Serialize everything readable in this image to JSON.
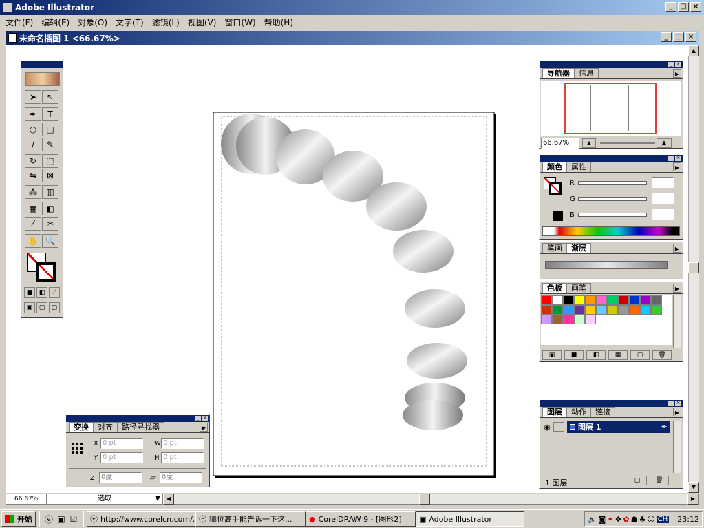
{
  "app": {
    "title": "Adobe Illustrator"
  },
  "menu": [
    "文件(F)",
    "编辑(E)",
    "对象(O)",
    "文字(T)",
    "滤镜(L)",
    "视图(V)",
    "窗口(W)",
    "帮助(H)"
  ],
  "document": {
    "title": "未命名插图 1 <66.67%>"
  },
  "navigator": {
    "tabs": [
      "导航器",
      "信息"
    ],
    "zoom": "66.67%"
  },
  "color": {
    "tabs": [
      "颜色",
      "属性"
    ],
    "channels": [
      "R",
      "G",
      "B"
    ]
  },
  "stroke_gradient": {
    "tabs": [
      "笔画",
      "渐层"
    ]
  },
  "swatches": {
    "tabs": [
      "色板",
      "画笔"
    ],
    "colors": [
      "#ff0000",
      "#ffffff",
      "#000000",
      "#ffff00",
      "#ff9900",
      "#ff66cc",
      "#00cc66",
      "#cc0000",
      "#0033cc",
      "#9900cc",
      "#666666",
      "#cc3300",
      "#009933",
      "#3399ff",
      "#663399",
      "#ffcc00",
      "#66ccff",
      "#cccc00",
      "#999999",
      "#ff6600",
      "#00ccff",
      "#33cc33",
      "#cc99ff",
      "#996633",
      "#ff3399",
      "#ccffcc",
      "#ffccff"
    ]
  },
  "layers": {
    "tabs": [
      "图层",
      "动作",
      "链接"
    ],
    "layer_name": "图层 1",
    "count": "1 图层"
  },
  "transform": {
    "tabs": [
      "变换",
      "对齐",
      "路径寻找器"
    ],
    "x_label": "X",
    "y_label": "Y",
    "w_label": "W",
    "h_label": "H",
    "x": "0 pt",
    "y": "0 pt",
    "w": "0 pt",
    "h": "0 pt",
    "angle": "0度",
    "shear": "0度"
  },
  "status": {
    "zoom": "66.67%",
    "tool": "选取"
  },
  "taskbar": {
    "start": "开始",
    "items": [
      "http://www.corelcn.com/...",
      "哪位高手能告诉一下这...",
      "CorelDRAW 9 - [图形2]",
      "Adobe Illustrator"
    ],
    "clock": "23:12",
    "ime": "CH"
  },
  "ellipses_data": [
    {
      "cx": 0.0,
      "cy": 0.0
    }
  ]
}
